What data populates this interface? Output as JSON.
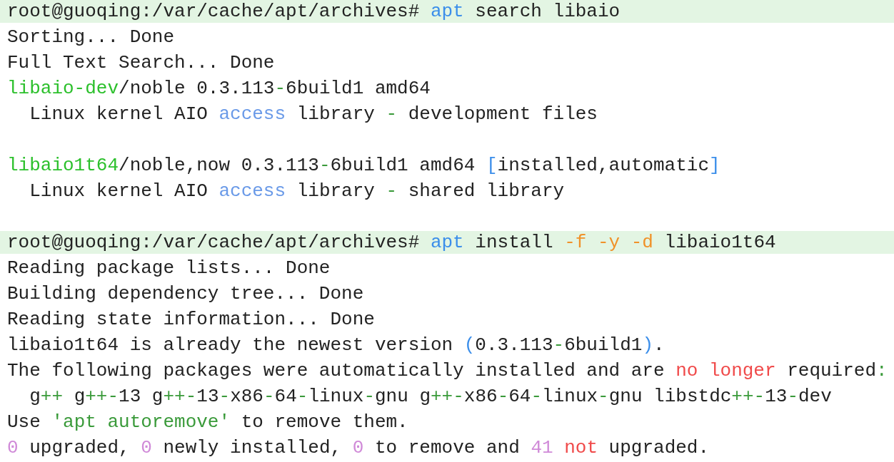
{
  "terminal": {
    "lines": [
      {
        "kind": "prompt",
        "segments": [
          {
            "text": "root@guoqing:/var/cache/apt/archives# "
          },
          {
            "text": "apt",
            "color": "#3b8eea"
          },
          {
            "text": " search libaio"
          }
        ]
      },
      {
        "kind": "output",
        "segments": [
          {
            "text": "Sorting... Done"
          }
        ]
      },
      {
        "kind": "output",
        "segments": [
          {
            "text": "Full Text Search... Done"
          }
        ]
      },
      {
        "kind": "output",
        "segments": [
          {
            "text": "libaio-dev",
            "color": "#2cc02c"
          },
          {
            "text": "/noble 0.3.113"
          },
          {
            "text": "-",
            "color": "#3a9a3a"
          },
          {
            "text": "6build1 amd64"
          }
        ]
      },
      {
        "kind": "output",
        "segments": [
          {
            "text": "  Linux kernel AIO "
          },
          {
            "text": "access",
            "color": "#6a9ae8"
          },
          {
            "text": " library "
          },
          {
            "text": "-",
            "color": "#3a9a3a"
          },
          {
            "text": " development files"
          }
        ]
      },
      {
        "kind": "blank"
      },
      {
        "kind": "output",
        "segments": [
          {
            "text": "libaio1t64",
            "color": "#2cc02c"
          },
          {
            "text": "/noble,now 0.3.113"
          },
          {
            "text": "-",
            "color": "#3a9a3a"
          },
          {
            "text": "6build1 amd64 "
          },
          {
            "text": "[",
            "color": "#3b8eea"
          },
          {
            "text": "installed,automatic"
          },
          {
            "text": "]",
            "color": "#3b8eea"
          }
        ]
      },
      {
        "kind": "output",
        "segments": [
          {
            "text": "  Linux kernel AIO "
          },
          {
            "text": "access",
            "color": "#6a9ae8"
          },
          {
            "text": " library "
          },
          {
            "text": "-",
            "color": "#3a9a3a"
          },
          {
            "text": " shared library"
          }
        ]
      },
      {
        "kind": "blank"
      },
      {
        "kind": "prompt",
        "segments": [
          {
            "text": "root@guoqing:/var/cache/apt/archives# "
          },
          {
            "text": "apt",
            "color": "#3b8eea"
          },
          {
            "text": " install "
          },
          {
            "text": "-f -y -d",
            "color": "#f0922a"
          },
          {
            "text": " libaio1t64"
          }
        ]
      },
      {
        "kind": "output",
        "segments": [
          {
            "text": "Reading package lists... Done"
          }
        ]
      },
      {
        "kind": "output",
        "segments": [
          {
            "text": "Building dependency tree... Done"
          }
        ]
      },
      {
        "kind": "output",
        "segments": [
          {
            "text": "Reading state information... Done"
          }
        ]
      },
      {
        "kind": "output",
        "segments": [
          {
            "text": "libaio1t64 is already the newest version "
          },
          {
            "text": "(",
            "color": "#3b8eea"
          },
          {
            "text": "0.3.113"
          },
          {
            "text": "-",
            "color": "#3a9a3a"
          },
          {
            "text": "6build1"
          },
          {
            "text": ")",
            "color": "#3b8eea"
          },
          {
            "text": "."
          }
        ]
      },
      {
        "kind": "output",
        "segments": [
          {
            "text": "The following packages were automatically installed and are "
          },
          {
            "text": "no longer",
            "color": "#f04a4a"
          },
          {
            "text": " required"
          },
          {
            "text": ":",
            "color": "#3a9a3a"
          }
        ]
      },
      {
        "kind": "output",
        "segments": [
          {
            "text": "  g"
          },
          {
            "text": "++",
            "color": "#3a9a3a"
          },
          {
            "text": " g"
          },
          {
            "text": "++-",
            "color": "#3a9a3a"
          },
          {
            "text": "13 g"
          },
          {
            "text": "++-",
            "color": "#3a9a3a"
          },
          {
            "text": "13"
          },
          {
            "text": "-",
            "color": "#3a9a3a"
          },
          {
            "text": "x86"
          },
          {
            "text": "-",
            "color": "#3a9a3a"
          },
          {
            "text": "64"
          },
          {
            "text": "-",
            "color": "#3a9a3a"
          },
          {
            "text": "linux"
          },
          {
            "text": "-",
            "color": "#3a9a3a"
          },
          {
            "text": "gnu g"
          },
          {
            "text": "++-",
            "color": "#3a9a3a"
          },
          {
            "text": "x86"
          },
          {
            "text": "-",
            "color": "#3a9a3a"
          },
          {
            "text": "64"
          },
          {
            "text": "-",
            "color": "#3a9a3a"
          },
          {
            "text": "linux"
          },
          {
            "text": "-",
            "color": "#3a9a3a"
          },
          {
            "text": "gnu libstdc"
          },
          {
            "text": "++-",
            "color": "#3a9a3a"
          },
          {
            "text": "13"
          },
          {
            "text": "-",
            "color": "#3a9a3a"
          },
          {
            "text": "dev"
          }
        ]
      },
      {
        "kind": "output",
        "segments": [
          {
            "text": "Use "
          },
          {
            "text": "'apt autoremove'",
            "color": "#3a9a3a"
          },
          {
            "text": " to remove them."
          }
        ]
      },
      {
        "kind": "output",
        "segments": [
          {
            "text": "0",
            "color": "#d08ad8"
          },
          {
            "text": " upgraded, "
          },
          {
            "text": "0",
            "color": "#d08ad8"
          },
          {
            "text": " newly installed, "
          },
          {
            "text": "0",
            "color": "#d08ad8"
          },
          {
            "text": " to remove and "
          },
          {
            "text": "41",
            "color": "#d08ad8"
          },
          {
            "text": " not",
            "color": "#f04a4a"
          },
          {
            "text": " upgraded."
          }
        ]
      }
    ]
  }
}
